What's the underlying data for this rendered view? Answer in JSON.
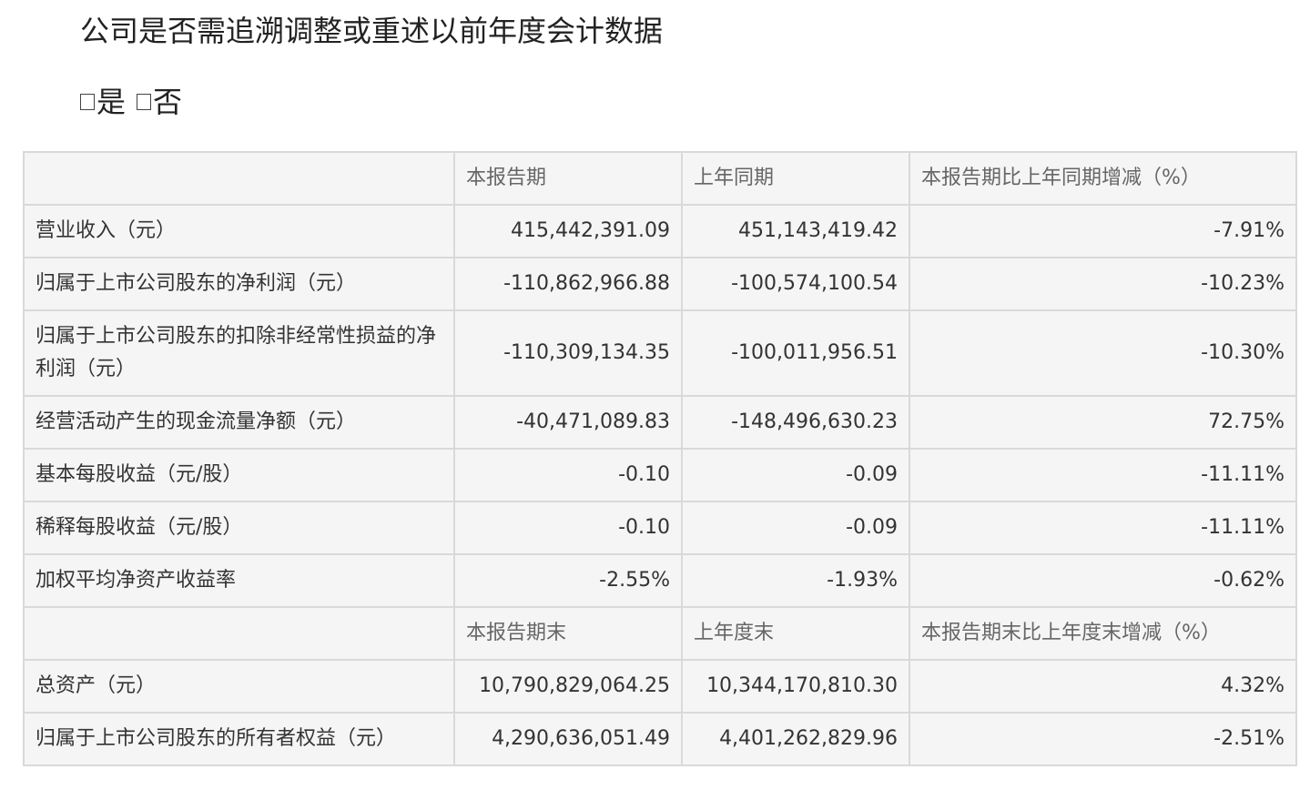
{
  "title": "公司是否需追溯调整或重述以前年度会计数据",
  "options": {
    "yes_label": "是",
    "no_label": "否"
  },
  "table": {
    "header1": [
      "",
      "本报告期",
      "上年同期",
      "本报告期比上年同期增减（%）"
    ],
    "rows1": [
      {
        "label": "营业收入（元）",
        "current": "415,442,391.09",
        "prior": "451,143,419.42",
        "change": "-7.91%"
      },
      {
        "label": "归属于上市公司股东的净利润（元）",
        "current": "-110,862,966.88",
        "prior": "-100,574,100.54",
        "change": "-10.23%"
      },
      {
        "label": "归属于上市公司股东的扣除非经常性损益的净利润（元）",
        "current": "-110,309,134.35",
        "prior": "-100,011,956.51",
        "change": "-10.30%"
      },
      {
        "label": "经营活动产生的现金流量净额（元）",
        "current": "-40,471,089.83",
        "prior": "-148,496,630.23",
        "change": "72.75%"
      },
      {
        "label": "基本每股收益（元/股）",
        "current": "-0.10",
        "prior": "-0.09",
        "change": "-11.11%"
      },
      {
        "label": "稀释每股收益（元/股）",
        "current": "-0.10",
        "prior": "-0.09",
        "change": "-11.11%"
      },
      {
        "label": "加权平均净资产收益率",
        "current": "-2.55%",
        "prior": "-1.93%",
        "change": "-0.62%"
      }
    ],
    "header2": [
      "",
      "本报告期末",
      "上年度末",
      "本报告期末比上年度末增减（%）"
    ],
    "rows2": [
      {
        "label": "总资产（元）",
        "current": "10,790,829,064.25",
        "prior": "10,344,170,810.30",
        "change": "4.32%"
      },
      {
        "label": "归属于上市公司股东的所有者权益（元）",
        "current": "4,290,636,051.49",
        "prior": "4,401,262,829.96",
        "change": "-2.51%"
      }
    ]
  }
}
